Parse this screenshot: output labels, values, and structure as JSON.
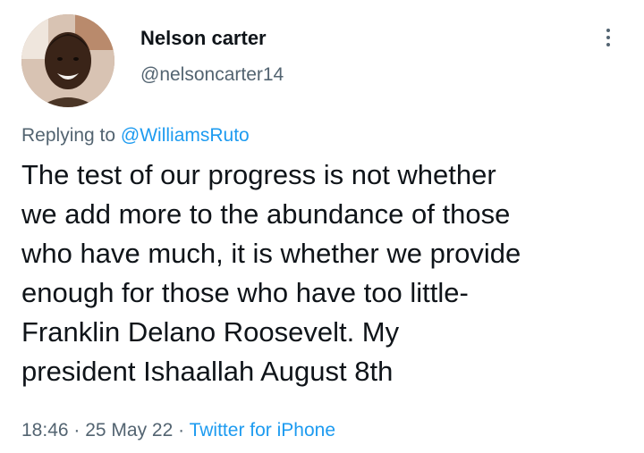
{
  "author": {
    "display_name": "Nelson carter",
    "handle": "@nelsoncarter14",
    "avatar": "profile-photo"
  },
  "reply": {
    "prefix": "Replying to ",
    "target": "@WilliamsRuto"
  },
  "tweet": {
    "text": "The test of our progress is not whether\nwe add more to the abundance of those\nwho have much, it is whether we provide\nenough for those who have too little-\nFranklin Delano Roosevelt.  My\npresident Ishaallah August 8th"
  },
  "meta": {
    "time": "18:46",
    "separator1": " · ",
    "date": "25 May 22",
    "separator2": " · ",
    "source": "Twitter for iPhone"
  },
  "icons": {
    "more": "more-vertical-icon"
  },
  "colors": {
    "link": "#1d9bf0",
    "secondary_text": "#536471",
    "primary_text": "#0f1419"
  }
}
